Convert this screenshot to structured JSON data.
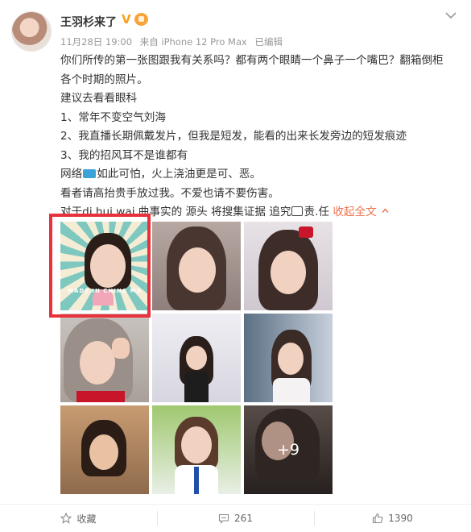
{
  "post": {
    "author": "王羽杉来了",
    "verified_mark": "V",
    "meta": {
      "date": "11月28日 19:00",
      "source": "来自 iPhone 12 Pro Max",
      "edited": "已编辑"
    },
    "lines": {
      "l1": "你们所传的第一张图跟我有关系吗？都有两个眼睛一个鼻子一个嘴巴？翻箱倒柜",
      "l2": "各个时期的照片。",
      "l3": "建议去看看眼科",
      "l4": "1、常年不变空气刘海",
      "l5": "2、我直播长期佩戴发片，但我是短发，能看的出来长发旁边的短发痕迹",
      "l6": "3、我的招风耳不是谁都有",
      "l7a": "网络",
      "l7b": "如此可怕，火上浇油更是可、恶。",
      "l8": "看者请高抬贵手放过我。不爱也请不要伤害。",
      "l9a": "对于di.hui.wai.曲事实的 源头 将搜集证据 追究",
      "l9b": "责.任",
      "collapse": "收起全文"
    },
    "image_grid": {
      "first_thumb_caption": "MADE IN CHINA MA",
      "extra_count": "+9"
    },
    "footer": {
      "favorite_label": "收藏",
      "comment_count": "261",
      "like_count": "1390"
    }
  },
  "colors": {
    "highlight_border": "#e8313b",
    "link": "#eb7350",
    "verified": "#f8a11c"
  }
}
